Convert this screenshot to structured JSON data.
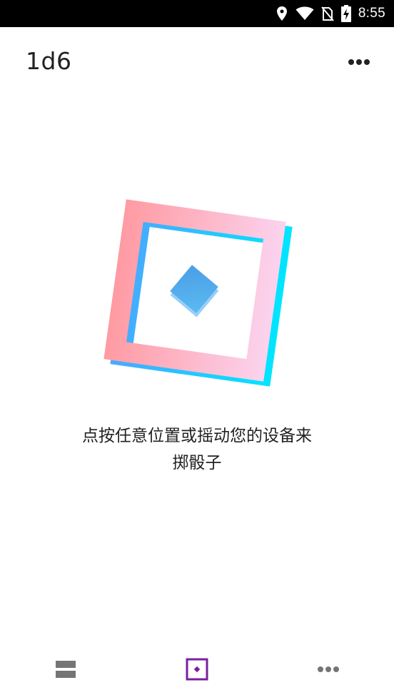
{
  "status_bar": {
    "time": "8:55",
    "icons": [
      "location-icon",
      "wifi-icon",
      "no-sim-icon",
      "battery-charging-icon"
    ]
  },
  "app_bar": {
    "title": "1d6",
    "overflow_icon": "more-horizontal-icon"
  },
  "main": {
    "prompt_line1": "点按任意位置或摇动您的设备来",
    "prompt_line2": "掷骰子",
    "die_colors": {
      "frame_start": "#ff9aa2",
      "frame_end": "#fbd3ee",
      "shadow_start": "#4aa8ff",
      "shadow_end": "#00e5ff",
      "pip": "#4a9ee6"
    }
  },
  "bottom_nav": {
    "items": [
      {
        "icon": "history-list-icon",
        "selected": false,
        "color": "#757575"
      },
      {
        "icon": "die-roll-icon",
        "selected": true,
        "color": "#7b1fa2"
      },
      {
        "icon": "more-horizontal-icon",
        "selected": false,
        "color": "#757575"
      }
    ]
  }
}
